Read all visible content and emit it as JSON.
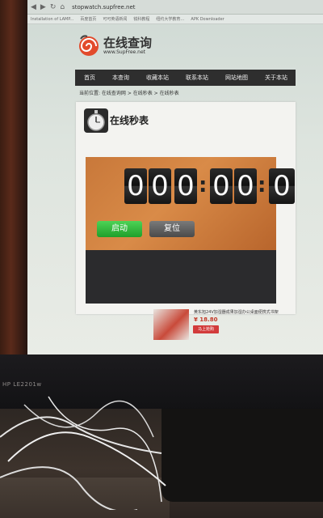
{
  "browser": {
    "url": "stopwatch.supfree.net",
    "bookmarks": [
      "Installation of LAMP...",
      "百度首页",
      "可可英语新闻",
      "锐科教程",
      "纽约大学教育…",
      "APK Downloader"
    ]
  },
  "site": {
    "logo_name": "在线查询",
    "logo_domain": "www.SupFree.net"
  },
  "nav": {
    "items": [
      "首页",
      "本查询",
      "收藏本站",
      "联系本站",
      "网站地图",
      "关于本站"
    ]
  },
  "breadcrumb": "当前位置: 在线查询网 > 在线秒表 > 在线秒表",
  "page_title": "在线秒表",
  "stopwatch": {
    "digits": [
      "0",
      "0",
      "0",
      "0",
      "0",
      "0"
    ],
    "separator": ":",
    "start_label": "启动",
    "reset_label": "复位"
  },
  "ad": {
    "title": "黄东旭24V加湿器成果加湿办公桌面便携式书架",
    "price": "¥ 18.80",
    "buy_label": "马上抢购"
  },
  "monitor": {
    "model_label": "HP LE2201w"
  },
  "icons": {
    "logo": "spiral-logo-icon",
    "page": "stopwatch-icon"
  },
  "colors": {
    "navbar": "#2e2e2e",
    "start_button": "#2fb33b",
    "reset_button": "#5d5d5d",
    "board": "#cf7d3e"
  }
}
